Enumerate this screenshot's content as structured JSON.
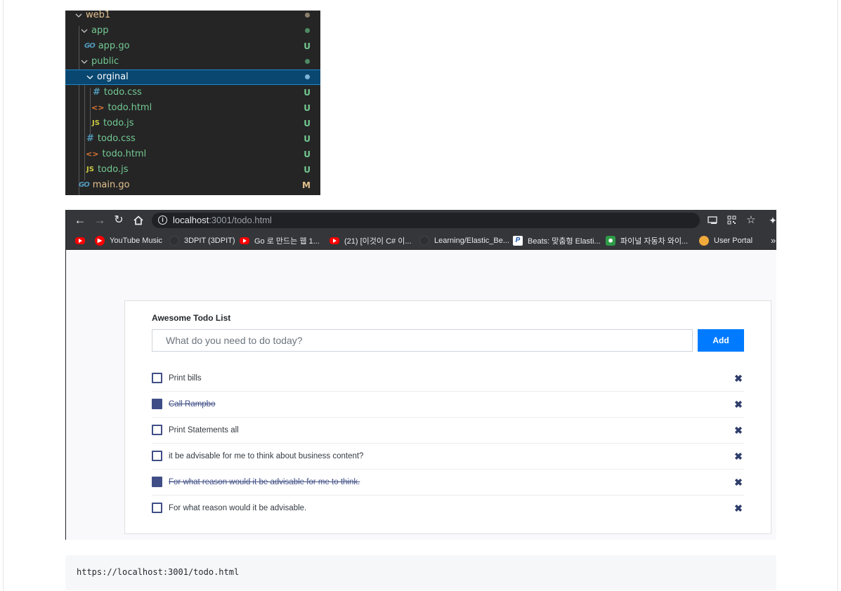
{
  "explorer": {
    "rows": [
      {
        "label": "web1",
        "icon": "chevron-down-icon",
        "status": "dot"
      },
      {
        "label": "app",
        "icon": "chevron-down-icon",
        "status": "dot"
      },
      {
        "label": "app.go",
        "icon": "go-file-icon",
        "icon_text": "GO",
        "status": "U"
      },
      {
        "label": "public",
        "icon": "chevron-down-icon",
        "status": "dot"
      },
      {
        "label": "orginal",
        "icon": "chevron-down-icon",
        "status": "dot"
      },
      {
        "label": "todo.css",
        "icon": "css-file-icon",
        "icon_text": "#",
        "status": "U"
      },
      {
        "label": "todo.html",
        "icon": "html-file-icon",
        "icon_text": "<>",
        "status": "U"
      },
      {
        "label": "todo.js",
        "icon": "js-file-icon",
        "icon_text": "JS",
        "status": "U"
      },
      {
        "label": "todo.css",
        "icon": "css-file-icon",
        "icon_text": "#",
        "status": "U"
      },
      {
        "label": "todo.html",
        "icon": "html-file-icon",
        "icon_text": "<>",
        "status": "U"
      },
      {
        "label": "todo.js",
        "icon": "js-file-icon",
        "icon_text": "JS",
        "status": "U"
      },
      {
        "label": "main.go",
        "icon": "go-file-icon",
        "icon_text": "GO",
        "status": "M"
      }
    ],
    "colors": {
      "untracked": "#73c991",
      "modified": "#e2c08d",
      "selected_bg": "#094771"
    }
  },
  "browser": {
    "url_host": "localhost",
    "url_rest": ":3001/todo.html",
    "bookmarks": [
      {
        "label": "",
        "icon": "youtube-icon"
      },
      {
        "label": "YouTube Music",
        "icon": "youtube-music-icon"
      },
      {
        "label": "3DPIT (3DPIT)",
        "icon": "github-icon"
      },
      {
        "label": "Go 로 만드는 웹 1...",
        "icon": "youtube-icon"
      },
      {
        "label": "(21) [이것이 C# 이...",
        "icon": "youtube-icon"
      },
      {
        "label": "Learning/Elastic_Be...",
        "icon": "github-icon"
      },
      {
        "label": "Beats: 맞춤형 Elasti...",
        "icon": "p-bookmark-icon"
      },
      {
        "label": "파이널 자동차 와이...",
        "icon": "hexagon-icon"
      },
      {
        "label": "User Portal",
        "icon": "user-portal-icon"
      }
    ]
  },
  "todo": {
    "title": "Awesome Todo List",
    "input_placeholder": "What do you need to do today?",
    "add_label": "Add",
    "items": [
      {
        "text": "Print bills",
        "completed": false
      },
      {
        "text": "Call Rampbo",
        "completed": true
      },
      {
        "text": "Print Statements all",
        "completed": false
      },
      {
        "text": "it be advisable for me to think about business content?",
        "completed": false
      },
      {
        "text": "For what reason would it be advisable for me to think.",
        "completed": true
      },
      {
        "text": "For what reason would it be advisable.",
        "completed": false
      }
    ],
    "accent_color": "#3f4e86",
    "button_color": "#007bff"
  },
  "code": {
    "text": "https://localhost:3001/todo.html"
  }
}
